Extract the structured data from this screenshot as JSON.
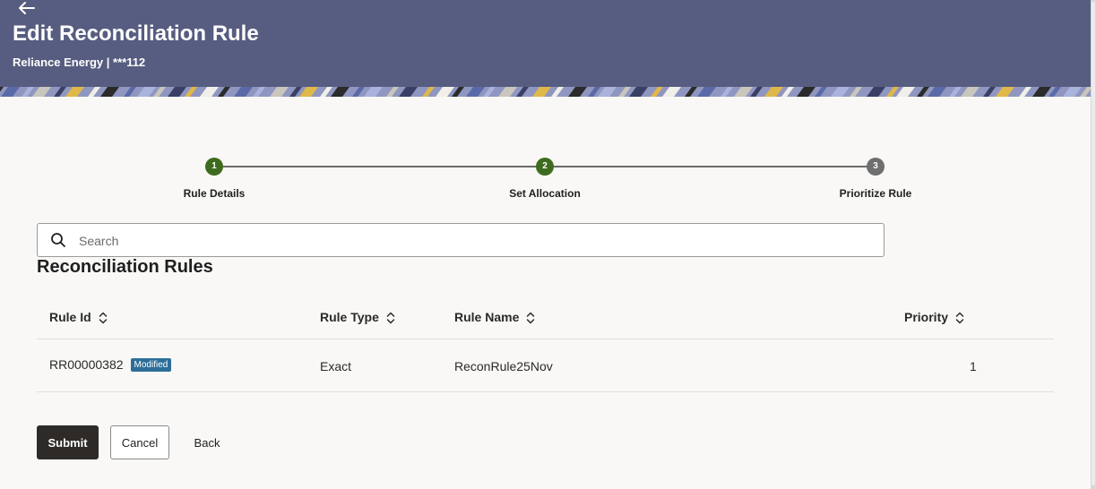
{
  "header": {
    "title": "Edit Reconciliation Rule",
    "subtitle": "Reliance Energy | ***112",
    "back_icon": "arrow-left-icon"
  },
  "stepper": {
    "steps": [
      {
        "number": "1",
        "label": "Rule Details",
        "state": "completed"
      },
      {
        "number": "2",
        "label": "Set Allocation",
        "state": "completed"
      },
      {
        "number": "3",
        "label": "Prioritize Rule",
        "state": "current"
      }
    ]
  },
  "search": {
    "placeholder": "Search",
    "value": ""
  },
  "section": {
    "title": "Reconciliation Rules"
  },
  "table": {
    "columns": [
      "Rule Id",
      "Rule Type",
      "Rule Name",
      "Priority"
    ],
    "rows": [
      {
        "rule_id": "RR00000382",
        "badge": "Modified",
        "rule_type": "Exact",
        "rule_name": "ReconRule25Nov",
        "priority": "1"
      }
    ]
  },
  "actions": {
    "submit": "Submit",
    "cancel": "Cancel",
    "back": "Back"
  },
  "colors": {
    "header_bg": "#575d80",
    "step_completed": "#3f6b1f",
    "step_pending": "#6f6f6f",
    "badge_bg": "#2c6e99",
    "primary_button": "#2d2a28"
  }
}
